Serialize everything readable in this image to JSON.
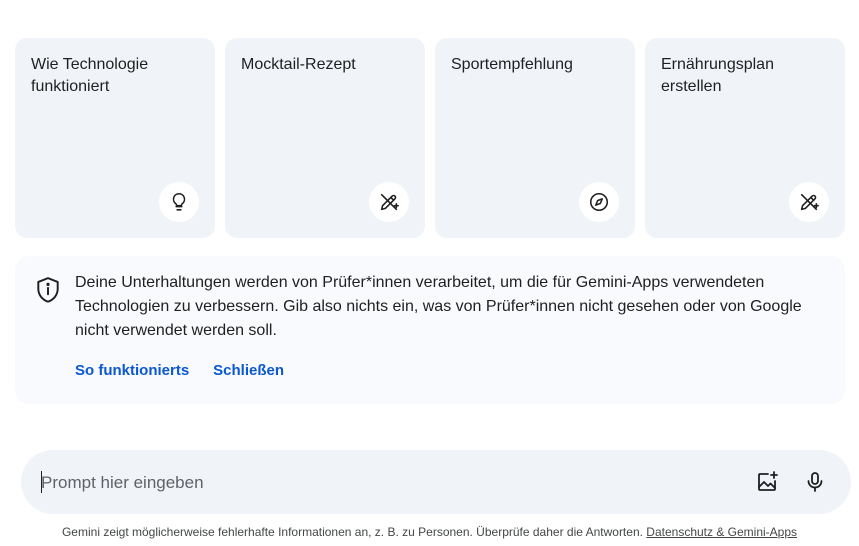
{
  "cards": [
    {
      "title": "Wie Technologie funktioniert",
      "icon": "lightbulb-icon"
    },
    {
      "title": "Mocktail-Rezept",
      "icon": "edit-sparkle-icon"
    },
    {
      "title": "Sportempfehlung",
      "icon": "compass-icon"
    },
    {
      "title": "Ernährungsplan erstellen",
      "icon": "edit-sparkle-icon"
    }
  ],
  "notice": {
    "icon": "shield-icon",
    "text": "Deine Unterhaltungen werden von Prüfer*innen verarbeitet, um die für Gemini-Apps verwendeten Technologien zu verbessern. Gib also nichts ein, was von Prüfer*innen nicht gesehen oder von Google nicht verwendet werden soll.",
    "link_how": "So funktionierts",
    "link_close": "Schließen"
  },
  "prompt": {
    "placeholder": "Prompt hier eingeben",
    "value": "",
    "image_icon": "add-image-icon",
    "mic_icon": "microphone-icon"
  },
  "footer": {
    "text": "Gemini zeigt möglicherweise fehlerhafte Informationen an, z. B. zu Personen. Überprüfe daher die Antworten.",
    "link": "Datenschutz & Gemini-Apps"
  },
  "colors": {
    "card_bg": "#f0f4f9",
    "notice_bg": "#f8fafd",
    "link": "#0b57d0",
    "text": "#1f1f1f"
  }
}
